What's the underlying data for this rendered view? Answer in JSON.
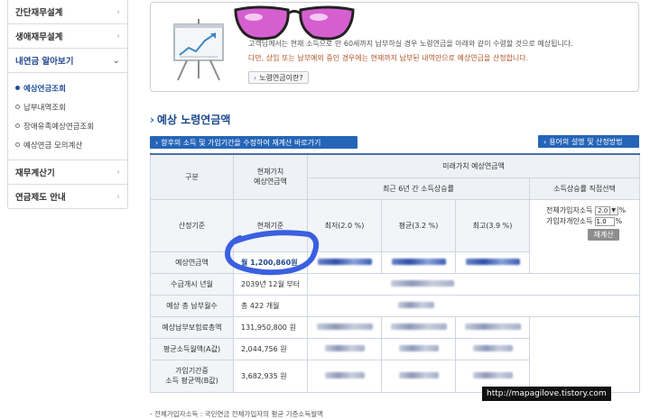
{
  "sidebar": {
    "items": [
      {
        "label": "간단재무설계"
      },
      {
        "label": "생애재무설계"
      },
      {
        "label": "내연금 알아보기"
      },
      {
        "label": "재무계산기"
      },
      {
        "label": "연금제도 안내"
      }
    ],
    "subitems": [
      {
        "label": "예상연금조회"
      },
      {
        "label": "납부내역조회"
      },
      {
        "label": "장애유족예상연금조회"
      },
      {
        "label": "예상연금 모의계산"
      }
    ]
  },
  "intro": {
    "line1": "고객님께서는 현재 소득으로 만 60세까지 납부하실 경우 노령연금을 아래와 같이 수령할 것으로 예상됩니다.",
    "line2": "다만, 상임 또는 납부예외 중인 경우에는 현재까지 납부된 내역만으로 예상연금을 산정합니다.",
    "button": "노령연금이란?"
  },
  "title": "예상 노령연금액",
  "links": {
    "recalc": "향후의 소득 및 가입기간을 수정하여 재계산 바로가기",
    "terms": "용어의 설명 및 산정방법"
  },
  "table": {
    "h_category": "구분",
    "h_current_l1": "현재가치",
    "h_current_l2": "예상연금액",
    "h_future": "미래가치 예상연금액",
    "h_recent": "최근 6년 간 소득상승률",
    "h_direct": "소득상승률 직접선택",
    "row_basis": "산정기준",
    "current_basis": "현재기준",
    "rate_low": "최저(2.0 %)",
    "rate_avg": "평균(3.2 %)",
    "rate_high": "최고(3.9 %)",
    "input_label1": "전체가입자소득",
    "input_value1": "2.0",
    "input_label2": "가입자개인소득",
    "input_value2": "1.0",
    "pct": "%",
    "recalc_btn": "재계산",
    "rows": [
      {
        "label": "예상연금액",
        "current": "월 1,200,860원"
      },
      {
        "label": "수급개시 년월",
        "current": "2039년 12월 부터"
      },
      {
        "label": "예상 총 납부월수",
        "current": "총 422 개월"
      },
      {
        "label": "예상납부보험료총액",
        "current": "131,950,800 원"
      },
      {
        "label": "평균소득월액(A값)",
        "current": "2,044,756 원"
      },
      {
        "label_l1": "가입기간중",
        "label_l2": "소득 평균액(B값)",
        "current": "3,682,935 원"
      }
    ]
  },
  "footnote": "- 전체가입자소득 : 국민연금 전체가입자의 평균 기준소득월액",
  "watermark": "http://mapagilove.tistory.com"
}
